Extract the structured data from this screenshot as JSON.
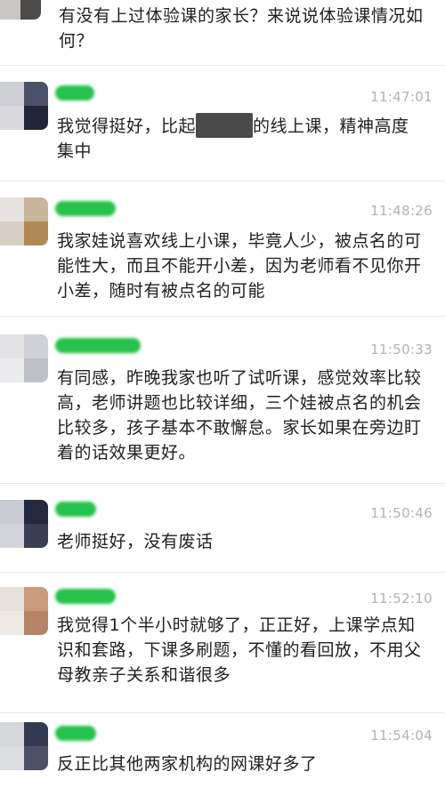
{
  "messages": [
    {
      "time": "",
      "text": "有没有上过体验课的家长？来说说体验课情况如何？"
    },
    {
      "time": "11:47:01",
      "text_before": "我觉得挺好，比起",
      "text_after": "的线上课，精神高度集中"
    },
    {
      "time": "11:48:26",
      "text": "我家娃说喜欢线上小课，毕竟人少，被点名的可能性大，而且不能开小差，因为老师看不见你开小差，随时有被点名的可能"
    },
    {
      "time": "11:50:33",
      "text": "有同感，昨晚我家也听了试听课，感觉效率比较高，老师讲题也比较详细，三个娃被点名的机会比较多，孩子基本不敢懈怠。家长如果在旁边盯着的话效果更好。"
    },
    {
      "time": "11:50:46",
      "text": "老师挺好，没有废话"
    },
    {
      "time": "11:52:10",
      "text": "我觉得1个半小时就够了，正正好，上课学点知识和套路，下课多刷题，不懂的看回放，不用父母教亲子关系和谐很多"
    },
    {
      "time": "11:54:04",
      "text": "反正比其他两家机构的网课好多了"
    }
  ],
  "colors": {
    "name_blur": "#27c24c",
    "timestamp": "#b3b3b3",
    "divider": "#e6e6e6"
  },
  "icons": [
    "pixelated-avatar-icon"
  ]
}
